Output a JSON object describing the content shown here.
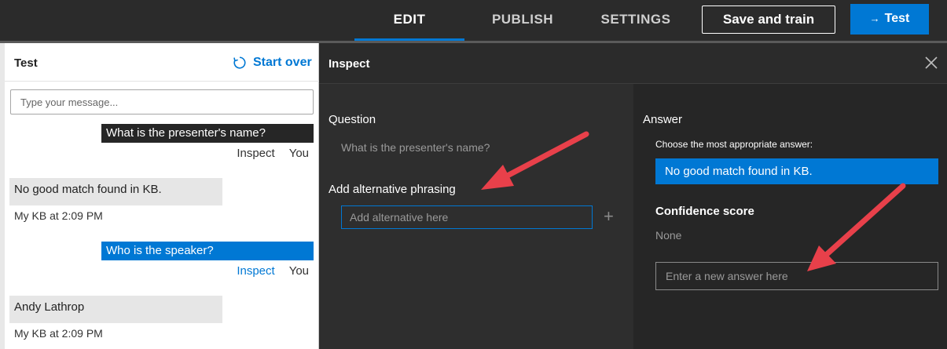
{
  "nav": {
    "tabs": [
      {
        "label": "EDIT",
        "active": true
      },
      {
        "label": "PUBLISH",
        "active": false
      },
      {
        "label": "SETTINGS",
        "active": false
      }
    ],
    "save_label": "Save and train",
    "test_label": "Test"
  },
  "test_panel": {
    "title": "Test",
    "start_over_label": "Start over",
    "input_placeholder": "Type your message...",
    "messages": [
      {
        "type": "user",
        "text": "What is the presenter's name?",
        "inspect_label": "Inspect",
        "sender": "You"
      },
      {
        "type": "bot",
        "text": "No good match found in KB.",
        "meta": "My KB at 2:09 PM"
      },
      {
        "type": "user",
        "text": "Who is the speaker?",
        "inspect_label": "Inspect",
        "sender": "You"
      },
      {
        "type": "bot",
        "text": "Andy Lathrop",
        "meta": "My KB at 2:09 PM"
      }
    ]
  },
  "inspect": {
    "title": "Inspect",
    "question_label": "Question",
    "question_text": "What is the presenter's name?",
    "alt_phrasing_label": "Add alternative phrasing",
    "alt_placeholder": "Add alternative here",
    "answer_label": "Answer",
    "choose_label": "Choose the most appropriate answer:",
    "selected_answer": "No good match found in KB.",
    "confidence_label": "Confidence score",
    "confidence_value": "None",
    "new_answer_placeholder": "Enter a new answer here"
  },
  "colors": {
    "accent": "#0078d4",
    "annotation_arrow": "#e8404a",
    "dark_bg": "#2b2b2b"
  }
}
